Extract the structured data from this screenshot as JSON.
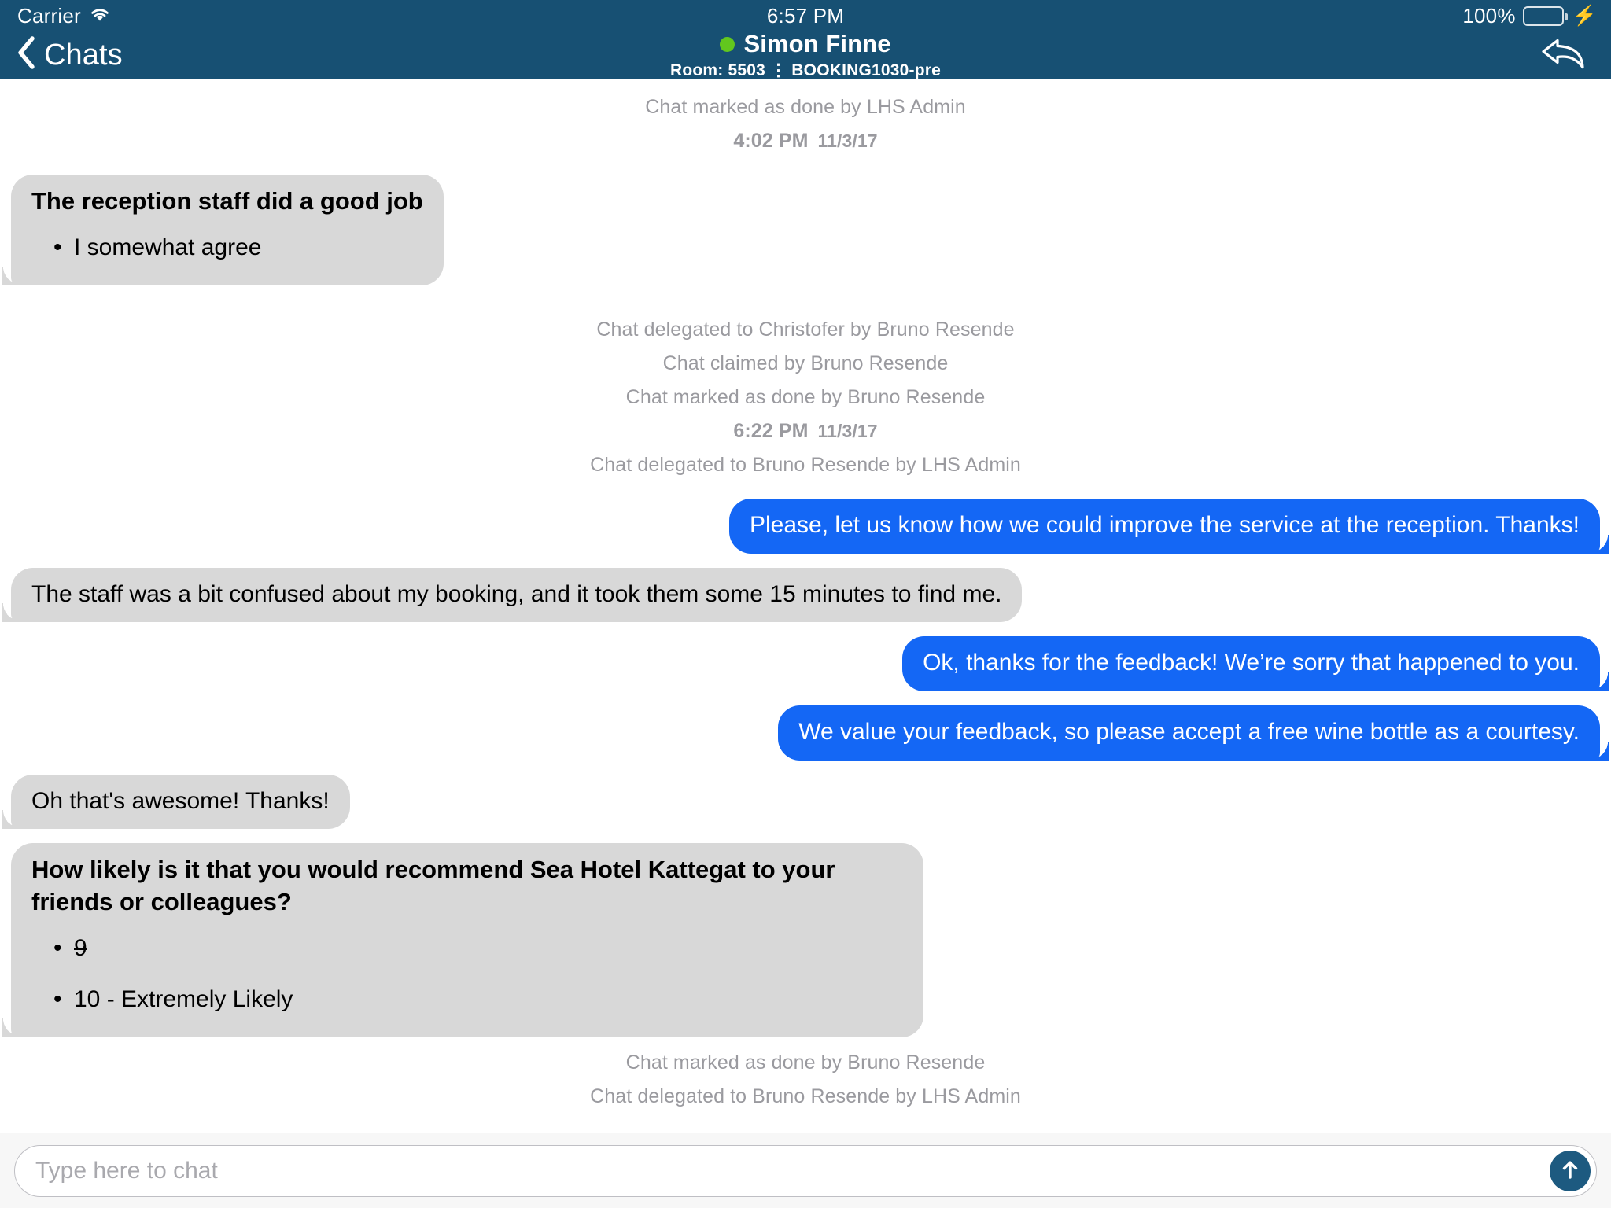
{
  "status_bar": {
    "carrier": "Carrier",
    "wifi_icon": "wifi-icon",
    "time": "6:57 PM",
    "battery_percent": "100%",
    "battery_icon": "battery-icon",
    "charging_icon": "lightning-bolt-icon"
  },
  "nav_bar": {
    "back_icon": "chevron-left-icon",
    "back_label": "Chats",
    "presence_icon": "online-status-dot",
    "title": "Simon Finne",
    "subtitle": "Room: 5503 ⋮ BOOKING1030-pre",
    "action_icon": "reply-arrow-icon"
  },
  "colors": {
    "header_bg": "#175073",
    "outgoing_bubble": "#1467F5",
    "incoming_bubble": "#D8D8D8",
    "system_text": "#9a9a9f",
    "presence_online": "#62C71E",
    "send_button": "#1D5A80",
    "battery_fill": "#4CD445"
  },
  "conversation": [
    {
      "kind": "system",
      "text": "Chat marked as done by LHS Admin"
    },
    {
      "kind": "timestamp",
      "time": "4:02 PM",
      "date": "11/3/17"
    },
    {
      "kind": "survey",
      "side": "incoming",
      "title": "The reception staff did a good job",
      "answers": [
        {
          "text": "I somewhat agree",
          "struck": false
        }
      ]
    },
    {
      "kind": "system",
      "text": "Chat delegated to Christofer by Bruno Resende"
    },
    {
      "kind": "system",
      "text": "Chat claimed by Bruno Resende"
    },
    {
      "kind": "system",
      "text": "Chat marked as done by Bruno Resende"
    },
    {
      "kind": "timestamp",
      "time": "6:22 PM",
      "date": "11/3/17"
    },
    {
      "kind": "system",
      "text": "Chat delegated to Bruno Resende by LHS Admin"
    },
    {
      "kind": "bubble",
      "side": "outgoing",
      "text": "Please, let us know how we could improve the service at the reception. Thanks!"
    },
    {
      "kind": "bubble",
      "side": "incoming",
      "text": "The staff was a bit confused about my booking, and it took them some 15 minutes to find me."
    },
    {
      "kind": "bubble",
      "side": "outgoing",
      "text": "Ok, thanks for the feedback! We’re sorry that happened to you."
    },
    {
      "kind": "bubble",
      "side": "outgoing",
      "text": "We value your feedback, so please accept a free wine bottle as a courtesy."
    },
    {
      "kind": "bubble",
      "side": "incoming",
      "text": "Oh that's awesome! Thanks!"
    },
    {
      "kind": "survey",
      "side": "incoming",
      "title": "How likely is it that you would recommend Sea Hotel Kattegat to your friends or colleagues?",
      "answers": [
        {
          "text": "9",
          "struck": true
        },
        {
          "text": "10 - Extremely Likely",
          "struck": false
        }
      ]
    },
    {
      "kind": "system",
      "text": "Chat marked as done by Bruno Resende"
    },
    {
      "kind": "system",
      "text": "Chat delegated to Bruno Resende by LHS Admin"
    }
  ],
  "composer": {
    "placeholder": "Type here to chat",
    "value": "",
    "send_icon": "arrow-up-icon"
  }
}
